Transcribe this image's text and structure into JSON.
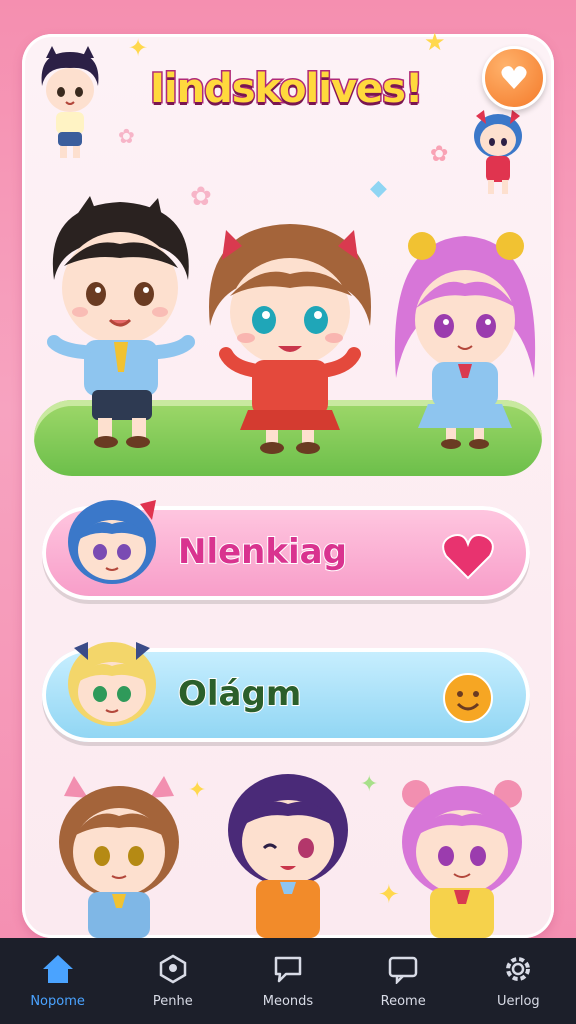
{
  "app": {
    "title": "Iindskolives!",
    "accent_pink": "#f79cc8",
    "accent_blue": "#8fd5f3",
    "nav_bg": "#1c1f2a"
  },
  "header": {
    "top_button_icon": "heart-chat-icon"
  },
  "menu": [
    {
      "label": "Nlenkiag",
      "icon": "heart-icon",
      "style": "pink"
    },
    {
      "label": "Olágm",
      "icon": "smiley-icon",
      "style": "blue"
    }
  ],
  "nav": [
    {
      "label": "Nopome",
      "icon": "home-icon",
      "active": true
    },
    {
      "label": "Penhe",
      "icon": "profile-icon",
      "active": false
    },
    {
      "label": "Meonds",
      "icon": "chat-icon",
      "active": false
    },
    {
      "label": "Reome",
      "icon": "message-icon",
      "active": false
    },
    {
      "label": "Uerlog",
      "icon": "gear-icon",
      "active": false
    }
  ]
}
